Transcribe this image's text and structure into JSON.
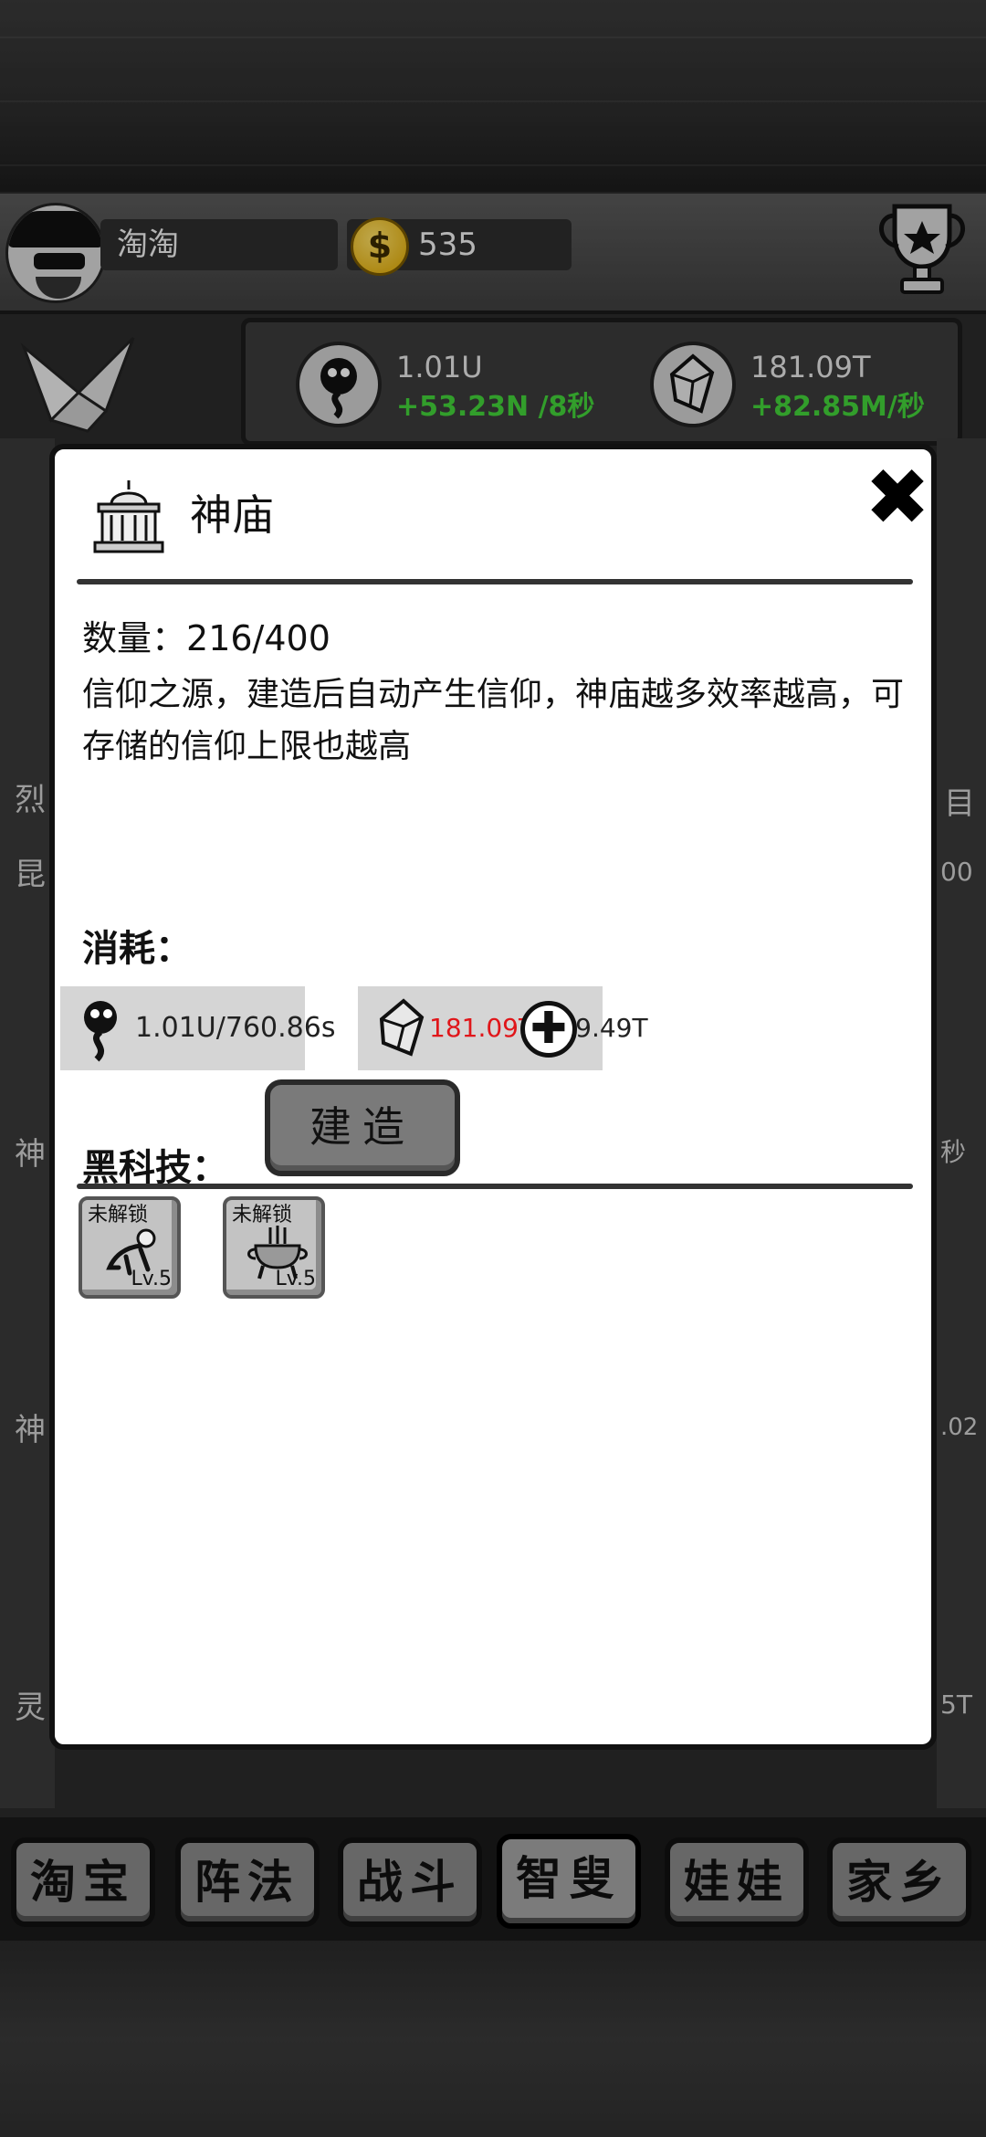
{
  "header": {
    "player_name": "淘淘",
    "coins": "535",
    "coin_symbol": "$"
  },
  "stats": {
    "faith": {
      "value": "1.01U",
      "rate": "+53.23N /8秒",
      "icon": "faith-spirit-icon"
    },
    "crystal": {
      "value": "181.09T",
      "rate": "+82.85M/秒",
      "icon": "crystal-icon"
    }
  },
  "background_labels": [
    "烈",
    "昆",
    "神",
    "神",
    "灵"
  ],
  "background_right": [
    "目",
    "00",
    "秒",
    ".02",
    "5T"
  ],
  "modal": {
    "title": "神庙",
    "icon": "temple-icon",
    "close": "✖",
    "quantity_label": "数量：",
    "quantity_value": "216/400",
    "description": "信仰之源，建造后自动产生信仰，神庙越多效率越高，可存储的信仰上限也越高",
    "cost_label": "消耗：",
    "costs": [
      {
        "icon": "faith-spirit-icon",
        "have": "1.01U",
        "need": "/760.86s",
        "insufficient": false
      },
      {
        "icon": "crystal-icon",
        "have": "181.09T",
        "need": "/239.49T",
        "insufficient": true
      }
    ],
    "plus": "✚",
    "build_label": "建造",
    "tech_label": "黑科技：",
    "tech": [
      {
        "status": "未解锁",
        "level": "Lv.5",
        "icon": "crawling-figure-icon"
      },
      {
        "status": "未解锁",
        "level": "Lv.5",
        "icon": "incense-burner-icon"
      }
    ]
  },
  "nav": {
    "items": [
      "淘宝",
      "阵法",
      "战斗",
      "智叟",
      "娃娃",
      "家乡"
    ],
    "active": "智叟"
  },
  "colors": {
    "rate_green": "#43d33a",
    "insufficient_red": "#e0161a",
    "modal_bg": "#ffffff",
    "cost_box_bg": "#d5d5d5"
  }
}
